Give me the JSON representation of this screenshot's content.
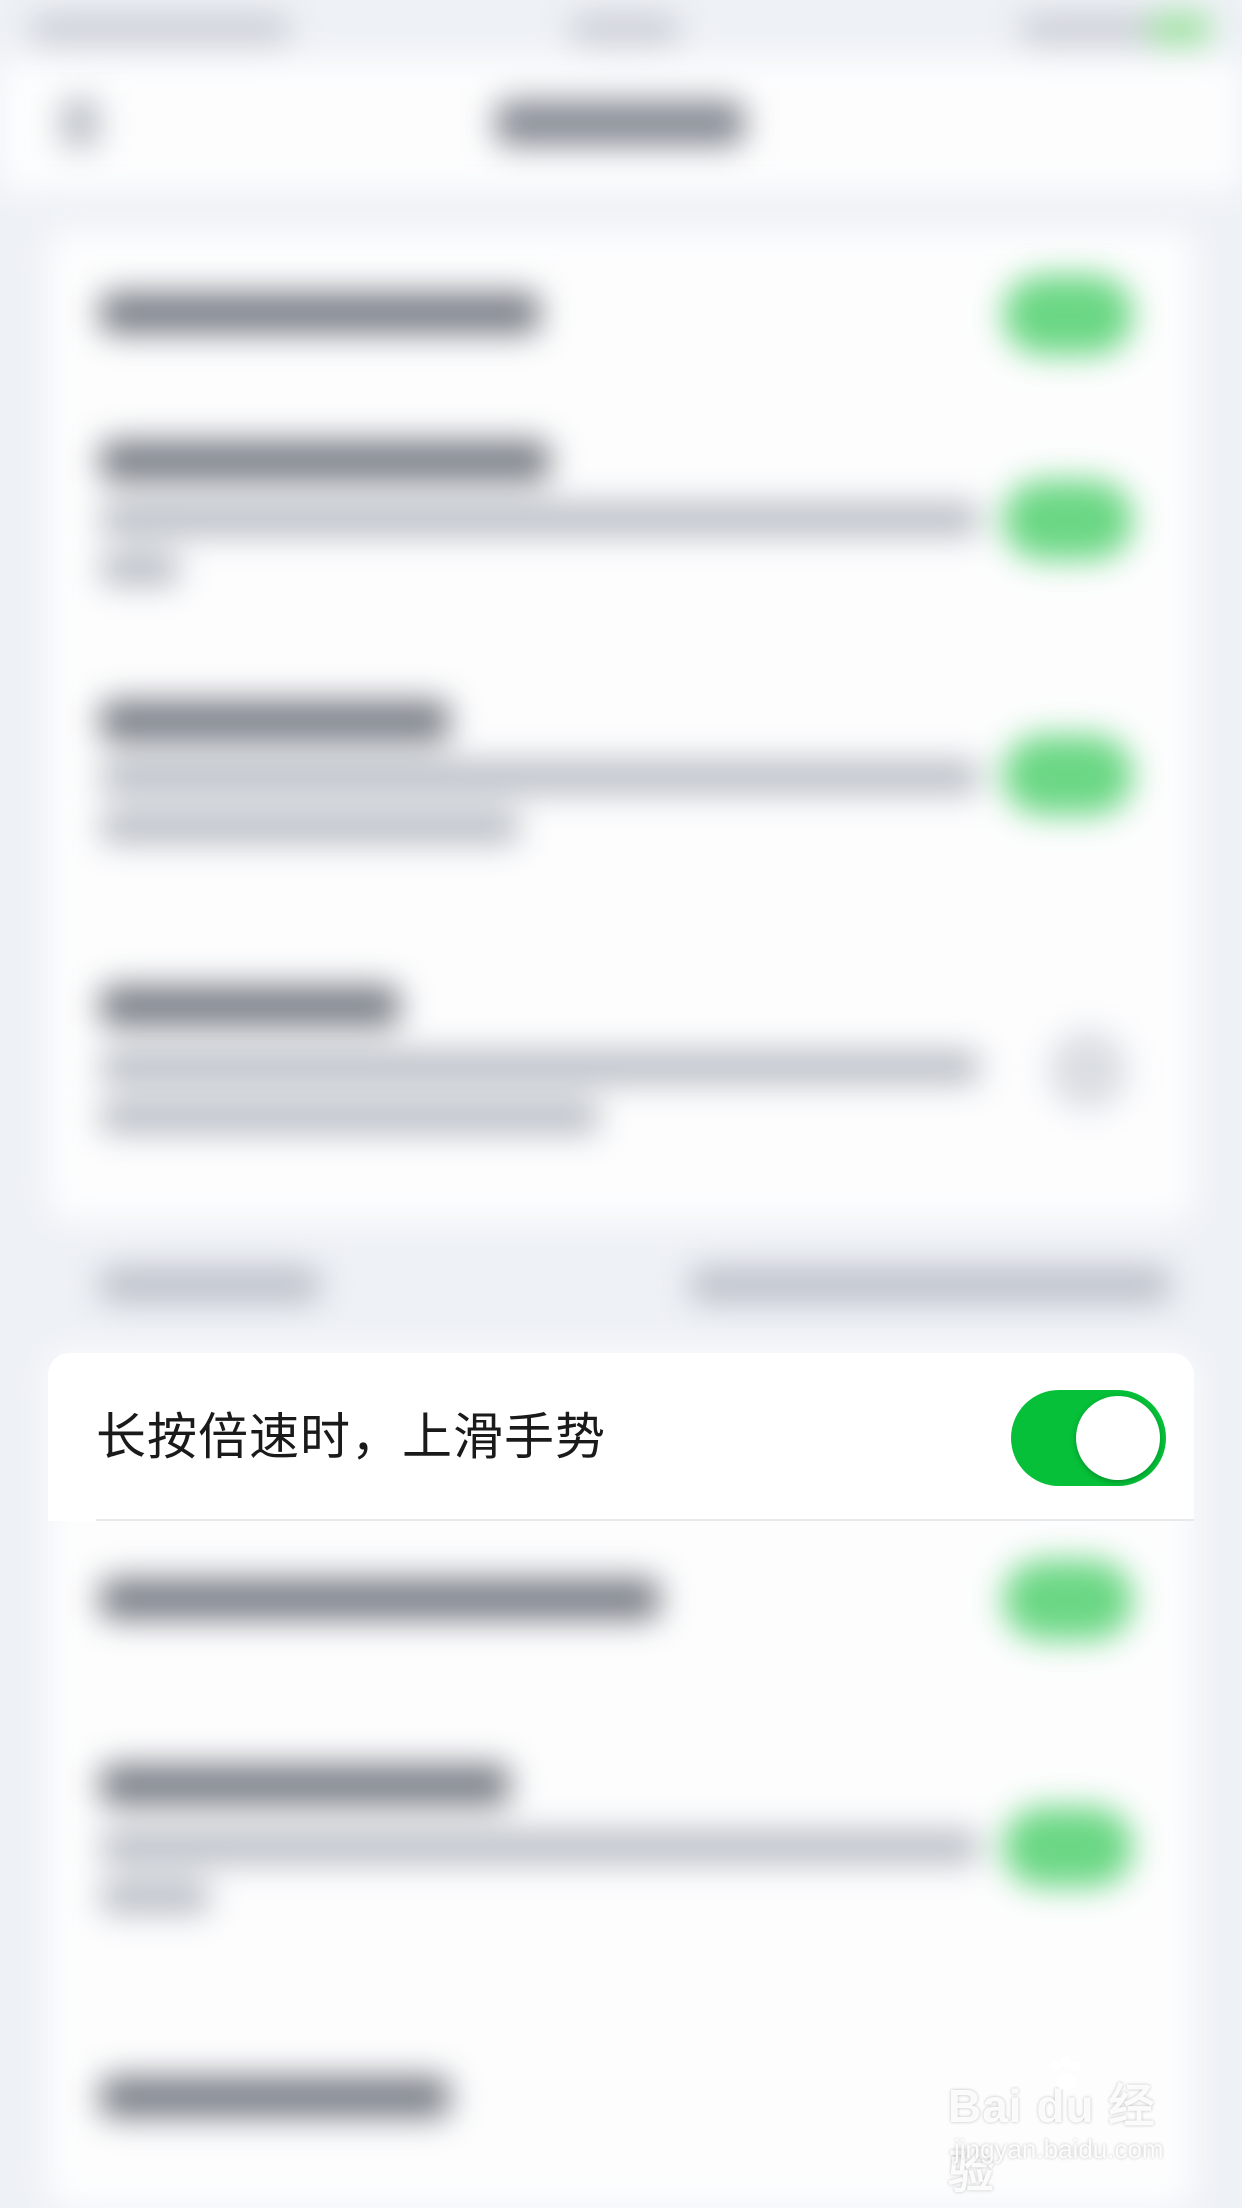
{
  "setting_row": {
    "label": "长按倍速时，上滑手势",
    "enabled": true
  },
  "colors": {
    "toggle_on": "#05c038",
    "background": "#eef1f6",
    "card": "#ffffff"
  },
  "watermark": {
    "logo": "Bai du 经验",
    "url": "jingyan.baidu.com"
  }
}
